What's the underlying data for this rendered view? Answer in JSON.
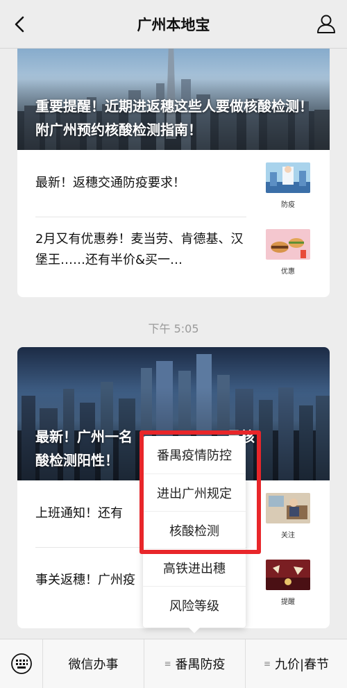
{
  "header": {
    "title": "广州本地宝",
    "back_icon": "back-arrow-icon",
    "profile_icon": "person-icon"
  },
  "card1": {
    "headline": "重要提醒！近期进返穗这些人要做核酸检测！附广州预约核酸检测指南！",
    "items": [
      {
        "text": "最新！返穗交通防疫要求！",
        "tag": "防疫"
      },
      {
        "text": "2月又有优惠券！麦当劳、肯德基、汉堡王……还有半价&买一…",
        "tag": "优惠"
      }
    ]
  },
  "timestamp": "下午 5:05",
  "card2": {
    "headline_left": "最新！广州一名",
    "headline_right": "员核",
    "headline_line2": "酸检测阳性！",
    "items": [
      {
        "text": "上班通知！还有",
        "tag": "关注"
      },
      {
        "text": "事关返穗！广州疫",
        "tag": "提醒"
      }
    ]
  },
  "popup": {
    "items": [
      "番禺疫情防控",
      "进出广州规定",
      "核酸检测",
      "高铁进出穗",
      "风险等级"
    ]
  },
  "bottom_bar": {
    "keyboard_icon": "keyboard-icon",
    "tabs": [
      "微信办事",
      "番禺防疫",
      "九价|春节"
    ],
    "menu_glyph": "≡"
  },
  "colors": {
    "highlight": "#e8262a",
    "background": "#ededed"
  }
}
